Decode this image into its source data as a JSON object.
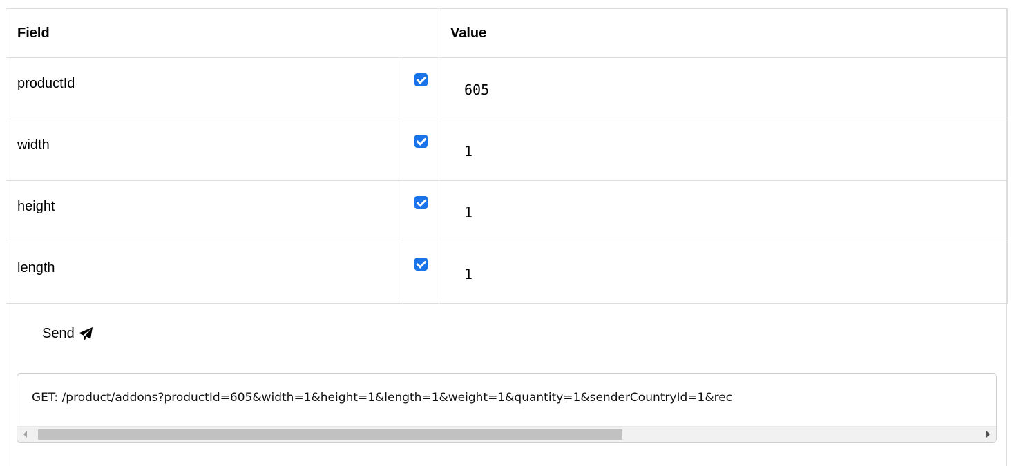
{
  "table": {
    "header_field": "Field",
    "header_value": "Value",
    "rows": [
      {
        "name": "productId",
        "checked": true,
        "value": "605"
      },
      {
        "name": "width",
        "checked": true,
        "value": "1"
      },
      {
        "name": "height",
        "checked": true,
        "value": "1"
      },
      {
        "name": "length",
        "checked": true,
        "value": "1"
      }
    ]
  },
  "send_label": "Send",
  "icons": {
    "send": "paper-plane-icon",
    "checkbox": "checkbox-checked-icon"
  },
  "request": {
    "text": "GET: /product/addons?productId=605&width=1&height=1&length=1&weight=1&quantity=1&senderCountryId=1&rec"
  },
  "colors": {
    "checkbox": "#1a73e8",
    "border": "#dddddd"
  }
}
